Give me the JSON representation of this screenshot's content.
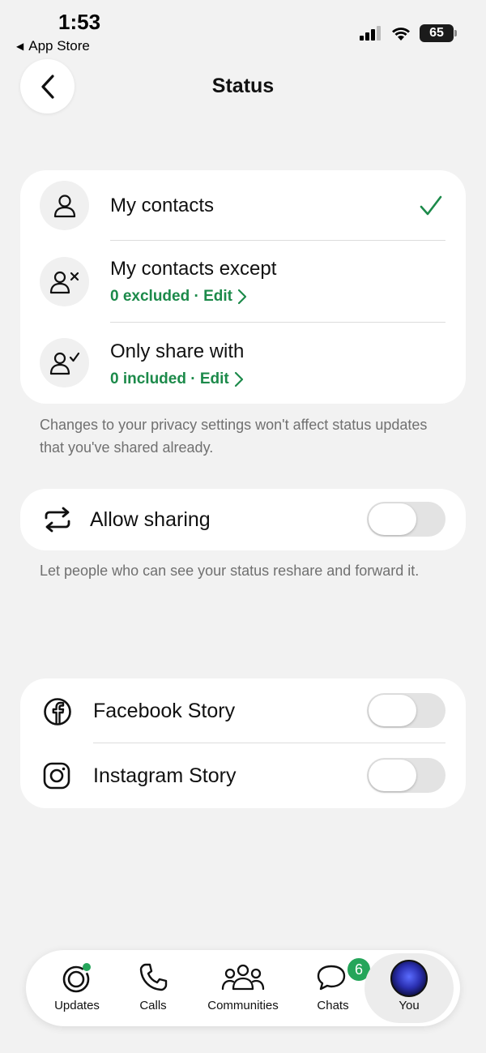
{
  "status_bar": {
    "time": "1:53",
    "back_app": "App Store",
    "battery": "65"
  },
  "header": {
    "title": "Status",
    "back_icon": "chevron-left-icon"
  },
  "privacy_options": [
    {
      "title": "My contacts",
      "subtitle": "",
      "icon": "person-icon",
      "selected": true
    },
    {
      "title": "My contacts except",
      "subtitle": "0 excluded · Edit",
      "icon": "person-x-icon",
      "selected": false
    },
    {
      "title": "Only share with",
      "subtitle": "0 included · Edit",
      "icon": "person-check-icon",
      "selected": false
    }
  ],
  "privacy_note": "Changes to your privacy settings won't affect status updates that you've shared already.",
  "sharing": {
    "label": "Allow sharing",
    "enabled": false,
    "note": "Let people who can see your status reshare and forward it."
  },
  "stories": [
    {
      "label": "Facebook Story",
      "icon": "facebook-icon",
      "enabled": false
    },
    {
      "label": "Instagram Story",
      "icon": "instagram-icon",
      "enabled": false
    }
  ],
  "tabbar": {
    "tabs": [
      {
        "label": "Updates",
        "icon": "updates-icon"
      },
      {
        "label": "Calls",
        "icon": "phone-icon"
      },
      {
        "label": "Communities",
        "icon": "communities-icon"
      },
      {
        "label": "Chats",
        "icon": "chats-icon",
        "badge": "6"
      },
      {
        "label": "You",
        "icon": "avatar",
        "active": true
      }
    ]
  },
  "colors": {
    "accent": "#1c8a4a",
    "badge": "#25a55a",
    "background": "#f2f2f2"
  }
}
